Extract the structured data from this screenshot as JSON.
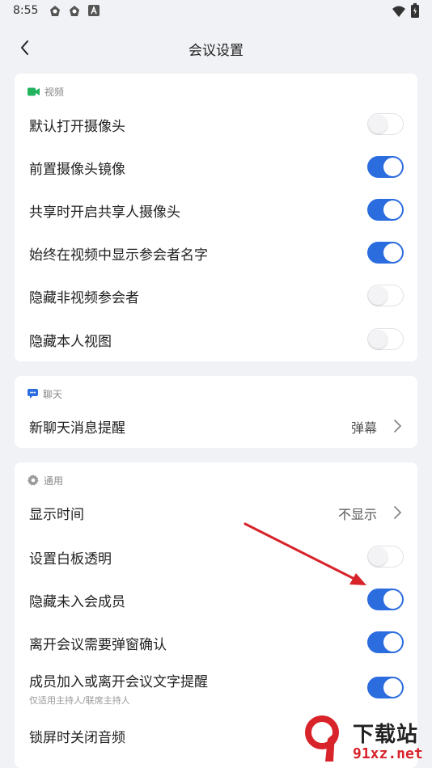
{
  "status_bar": {
    "time": "8:55"
  },
  "header": {
    "title": "会议设置"
  },
  "video": {
    "section_title": "视频",
    "rows": [
      {
        "label": "默认打开摄像头",
        "on": false
      },
      {
        "label": "前置摄像头镜像",
        "on": true
      },
      {
        "label": "共享时开启共享人摄像头",
        "on": true
      },
      {
        "label": "始终在视频中显示参会者名字",
        "on": true
      },
      {
        "label": "隐藏非视频参会者",
        "on": false
      },
      {
        "label": "隐藏本人视图",
        "on": false
      }
    ]
  },
  "chat": {
    "section_title": "聊天",
    "rows": [
      {
        "label": "新聊天消息提醒",
        "value": "弹幕"
      }
    ]
  },
  "general": {
    "section_title": "通用",
    "rows": [
      {
        "label": "显示时间",
        "value": "不显示"
      },
      {
        "label": "设置白板透明",
        "on": false
      },
      {
        "label": "隐藏未入会成员",
        "on": true
      },
      {
        "label": "离开会议需要弹窗确认",
        "on": true
      },
      {
        "label": "成员加入或离开会议文字提醒",
        "sub": "仅适用主持人/联席主持人",
        "on": true
      },
      {
        "label": "锁屏时关闭音频"
      }
    ]
  },
  "watermark": {
    "text": "下载站",
    "url": "91xz.net"
  },
  "colors": {
    "accent": "#2b6cdf",
    "video_icon": "#22b35e",
    "chat_icon": "#2b6cdf",
    "arrow": "#d8232a"
  }
}
